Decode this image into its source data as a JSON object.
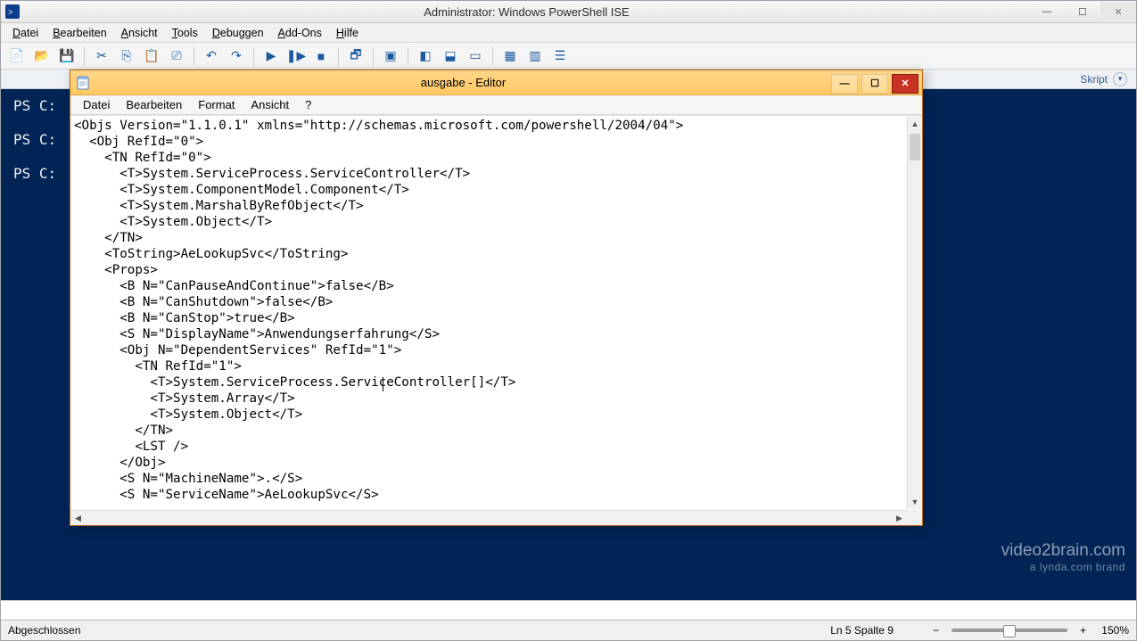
{
  "ise": {
    "title": "Administrator: Windows PowerShell ISE",
    "menus": [
      "Datei",
      "Bearbeiten",
      "Ansicht",
      "Tools",
      "Debuggen",
      "Add-Ons",
      "Hilfe"
    ],
    "skript_label": "Skript",
    "console_prompts": [
      "PS C:",
      "PS C:",
      "PS C:"
    ],
    "status_left": "Abgeschlossen",
    "status_pos": "Ln 5  Spalte 9",
    "zoom": "150%",
    "toolbar": [
      {
        "name": "new-file-icon",
        "glyph": "📄"
      },
      {
        "name": "open-file-icon",
        "glyph": "📂"
      },
      {
        "name": "save-icon",
        "glyph": "💾"
      },
      {
        "sep": true
      },
      {
        "name": "cut-icon",
        "glyph": "✂"
      },
      {
        "name": "copy-icon",
        "glyph": "⎘"
      },
      {
        "name": "paste-icon",
        "glyph": "📋"
      },
      {
        "name": "clear-icon",
        "glyph": "⎚"
      },
      {
        "sep": true
      },
      {
        "name": "undo-icon",
        "glyph": "↶"
      },
      {
        "name": "redo-icon",
        "glyph": "↷"
      },
      {
        "sep": true
      },
      {
        "name": "run-icon",
        "glyph": "▶"
      },
      {
        "name": "run-selection-icon",
        "glyph": "❚▶"
      },
      {
        "name": "stop-icon",
        "glyph": "■"
      },
      {
        "sep": true
      },
      {
        "name": "new-remote-icon",
        "glyph": "🗗"
      },
      {
        "sep": true
      },
      {
        "name": "launch-ps-icon",
        "glyph": "▣"
      },
      {
        "sep": true
      },
      {
        "name": "layout-sidebyside-icon",
        "glyph": "◧"
      },
      {
        "name": "layout-stacked-icon",
        "glyph": "⬓"
      },
      {
        "name": "layout-single-icon",
        "glyph": "▭"
      },
      {
        "sep": true
      },
      {
        "name": "show-command-icon",
        "glyph": "▦"
      },
      {
        "name": "show-addon-icon",
        "glyph": "▥"
      },
      {
        "name": "options-icon",
        "glyph": "☰"
      }
    ]
  },
  "editor": {
    "title": "ausgabe - Editor",
    "menus": [
      "Datei",
      "Bearbeiten",
      "Format",
      "Ansicht",
      "?"
    ],
    "content": "<Objs Version=\"1.1.0.1\" xmlns=\"http://schemas.microsoft.com/powershell/2004/04\">\n  <Obj RefId=\"0\">\n    <TN RefId=\"0\">\n      <T>System.ServiceProcess.ServiceController</T>\n      <T>System.ComponentModel.Component</T>\n      <T>System.MarshalByRefObject</T>\n      <T>System.Object</T>\n    </TN>\n    <ToString>AeLookupSvc</ToString>\n    <Props>\n      <B N=\"CanPauseAndContinue\">false</B>\n      <B N=\"CanShutdown\">false</B>\n      <B N=\"CanStop\">true</B>\n      <S N=\"DisplayName\">Anwendungserfahrung</S>\n      <Obj N=\"DependentServices\" RefId=\"1\">\n        <TN RefId=\"1\">\n          <T>System.ServiceProcess.ServiceController[]</T>\n          <T>System.Array</T>\n          <T>System.Object</T>\n        </TN>\n        <LST />\n      </Obj>\n      <S N=\"MachineName\">.</S>\n      <S N=\"ServiceName\">AeLookupSvc</S>"
  },
  "watermark": {
    "line1": "video2brain.com",
    "line2": "a lynda.com brand"
  }
}
